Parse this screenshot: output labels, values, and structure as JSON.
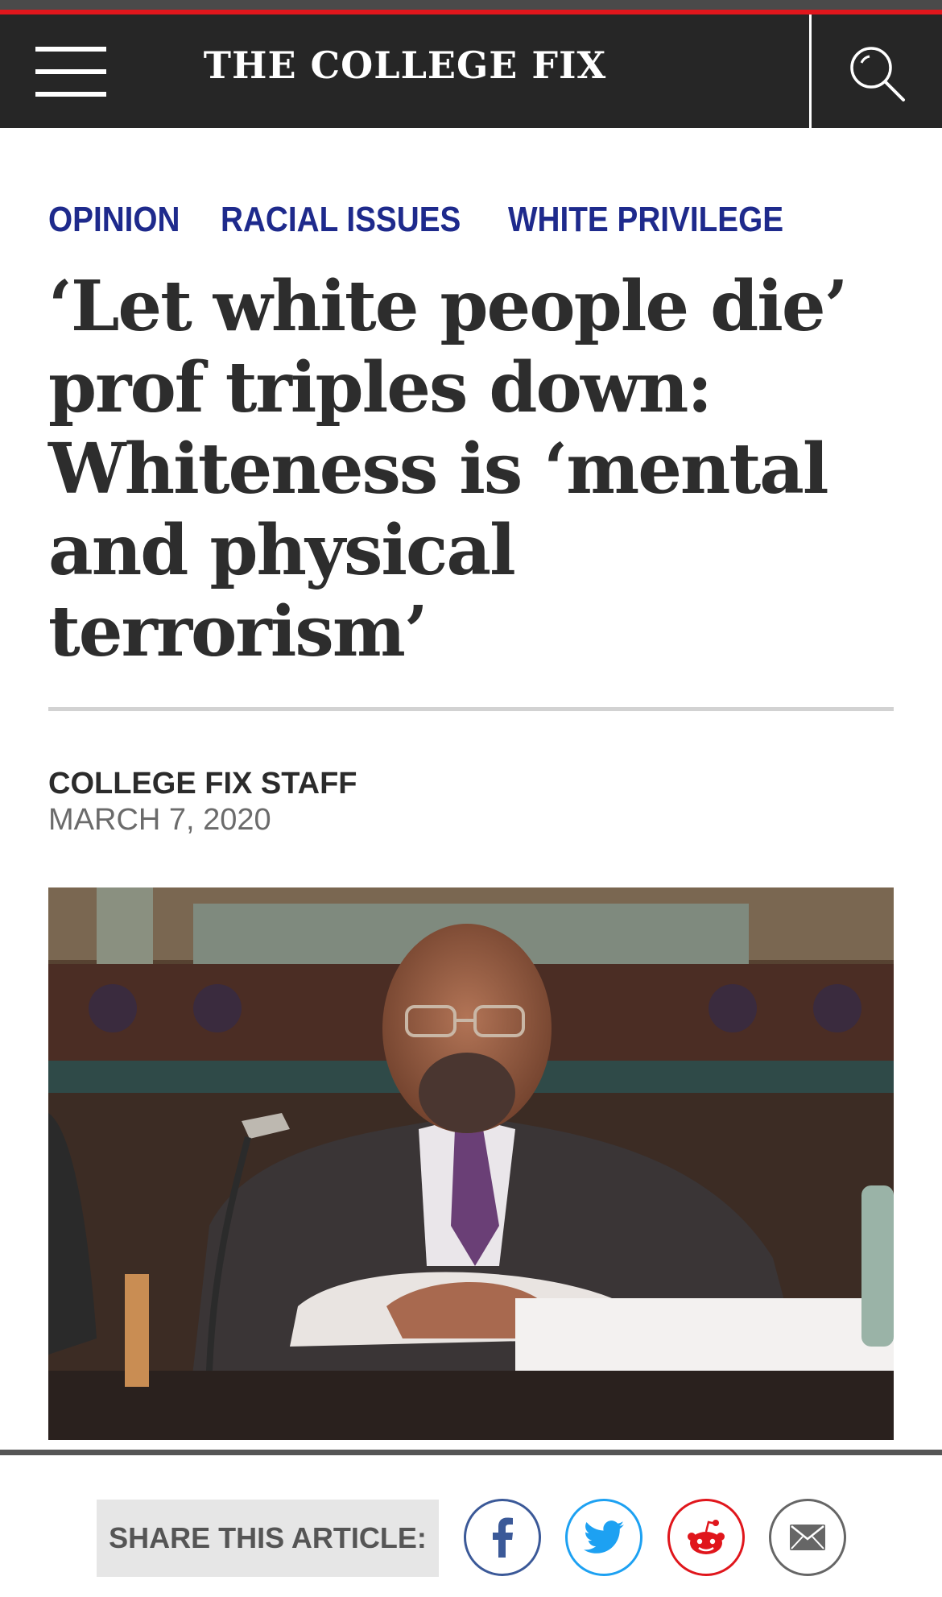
{
  "header": {
    "site_title": "THE COLLEGE FIX",
    "menu_icon": "hamburger-menu-icon",
    "search_icon": "search-icon",
    "accent_color": "#e0161c",
    "bar_color": "#262626"
  },
  "article": {
    "categories": [
      "OPINION",
      "RACIAL ISSUES",
      "WHITE PRIVILEGE"
    ],
    "category_color": "#1e2a8c",
    "headline_lines": [
      "‘Let white people die’",
      "prof triples down:",
      "Whiteness is ‘mental",
      "and physical",
      "terrorism’"
    ],
    "author": "COLLEGE FIX STAFF",
    "date": "MARCH 7, 2020"
  },
  "share": {
    "label": "SHARE THIS ARTICLE:",
    "buttons": [
      {
        "icon": "facebook-icon",
        "color": "#3b5998"
      },
      {
        "icon": "twitter-icon",
        "color": "#1da1f2"
      },
      {
        "icon": "reddit-icon",
        "color": "#e0161c"
      },
      {
        "icon": "email-icon",
        "color": "#666666"
      }
    ]
  }
}
